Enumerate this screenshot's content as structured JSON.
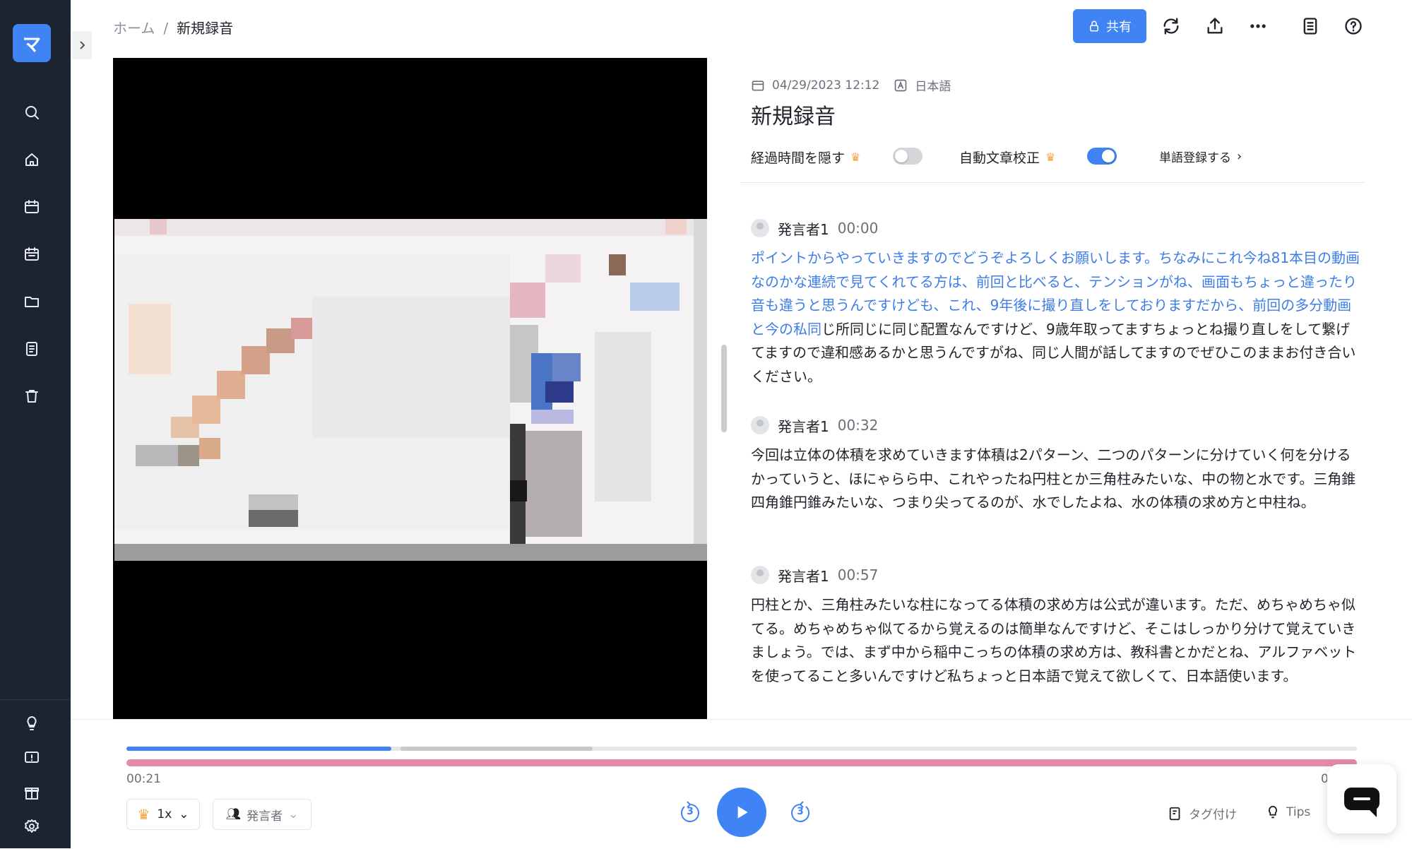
{
  "sidebar": {
    "logo_glyph": "マ",
    "icons": [
      "search-icon",
      "home-icon",
      "calendar-edit-icon",
      "calendar-icon",
      "folder-icon",
      "document-icon",
      "trash-icon",
      "lightbulb-icon",
      "feedback-icon",
      "gift-icon",
      "settings-icon"
    ]
  },
  "breadcrumb": {
    "home": "ホーム",
    "separator": "/",
    "current": "新規録音"
  },
  "toolbar": {
    "share_label": "共有"
  },
  "recording": {
    "datetime": "04/29/2023 12:12",
    "language": "日本語",
    "title": "新規録音"
  },
  "options": {
    "hide_elapsed_label": "経過時間を隠す",
    "hide_elapsed_on": false,
    "auto_correct_label": "自動文章校正",
    "auto_correct_on": true,
    "word_register_label": "単語登録する"
  },
  "segments": [
    {
      "speaker": "発言者1",
      "time": "00:00",
      "text_blue": "ポイントからやっていきますのでどうぞよろしくお願いします。ちなみにこれ今ね81本目の動画なのかな連続で見てくれてる方は、前回と比べると、テンションがね、画面もちょっと違ったり音も違うと思うんですけども、これ、9年後に撮り直しをしておりますだから、前回の多分動画と今の私同",
      "text_rest": "じ所同じに同じ配置なんですけど、9歳年取ってますちょっとね撮り直しをして繋げてますので違和感あるかと思うんですがね、同じ人間が話してますのでぜひこのままお付き合いください。"
    },
    {
      "speaker": "発言者1",
      "time": "00:32",
      "text_blue": "",
      "text_rest": "今回は立体の体積を求めていきます体積は2パターン、二つのパターンに分けていく何を分けるかっていうと、ほにゃらら中、これやったね円柱とか三角柱みたいな、中の物と水です。三角錐四角錐円錐みたいな、つまり尖ってるのが、水でしたよね、水の体積の求め方と中柱ね。"
    },
    {
      "speaker": "発言者1",
      "time": "00:57",
      "text_blue": "",
      "text_rest": "円柱とか、三角柱みたいな柱になってる体積の求め方は公式が違います。ただ、めちゃめちゃ似てる。めちゃめちゃ似てるから覚えるのは簡単なんですけど、そこはしっかり分けて覚えていきましょう。では、まず中から稲中こっちの体積の求め方は、教科書とかだとね、アルファベットを使ってること多いんですけど私ちょっと日本語で覚えて欲しくて、日本語使います。"
    }
  ],
  "player": {
    "current_time": "00:21",
    "end_time_partial": "0",
    "progress_fraction": 0.215,
    "speed_label": "1x",
    "speaker_filter_label": "発言者",
    "skip_back_seconds": "3",
    "skip_forward_seconds": "3",
    "tag_label": "タグ付け",
    "tips_label": "Tips"
  },
  "colors": {
    "accent": "#3f83f4",
    "sidebar": "#1c2331",
    "waveform": "#e58aa6"
  }
}
